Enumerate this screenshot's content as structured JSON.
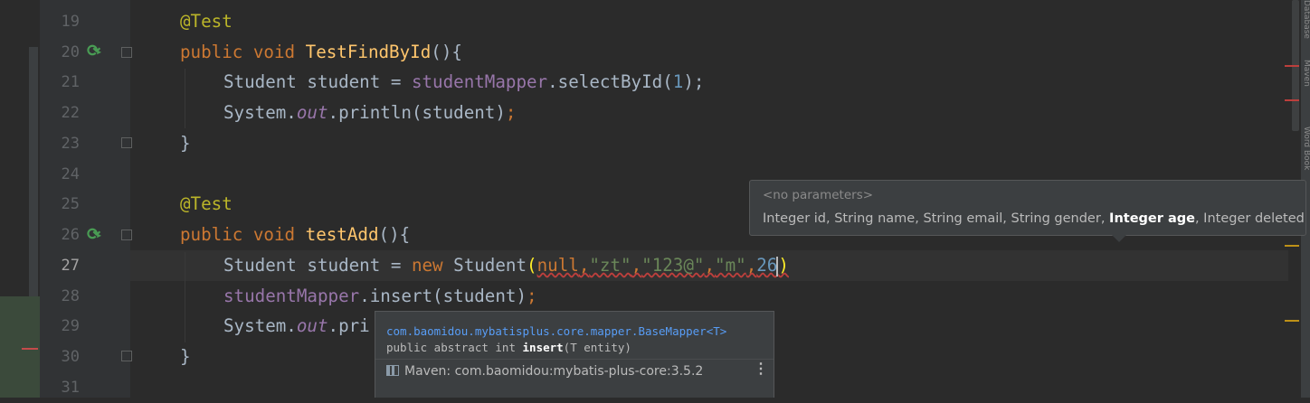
{
  "editor": {
    "line_numbers": [
      "19",
      "20",
      "21",
      "22",
      "23",
      "24",
      "25",
      "26",
      "27",
      "28",
      "29",
      "30",
      "31"
    ],
    "current_line": "27",
    "code": {
      "l19_annotation": "@Test",
      "l20_public": "public ",
      "l20_void": "void ",
      "l20_name": "TestFindById",
      "l20_rest": "(){",
      "l21_a": "Student student = ",
      "l21_field": "studentMapper",
      "l21_b": ".selectById(",
      "l21_num": "1",
      "l21_c": ");",
      "l22_a": "System.",
      "l22_field": "out",
      "l22_b": ".println(student)",
      "l22_c": ";",
      "l23": "}",
      "l25_annotation": "@Test",
      "l26_public": "public ",
      "l26_void": "void ",
      "l26_name": "testAdd",
      "l26_rest": "(){",
      "l27_a": "Student student = ",
      "l27_new": "new ",
      "l27_b": "Student",
      "l27_open": "(",
      "l27_null": "null",
      "l27_comma": ",",
      "l27_s1": "\"zt\"",
      "l27_s2": "\"123@\"",
      "l27_s3": "\"m\"",
      "l27_num": "26",
      "l27_close": ")",
      "l28_field": "studentMapper",
      "l28_b": ".insert(student)",
      "l28_c": ";",
      "l29_a": "System.",
      "l29_field": "out",
      "l29_b": ".pri",
      "l30": "}"
    }
  },
  "param_popup": {
    "hint": "<no parameters>",
    "sig_before": "Integer id, String name, String email, String gender, ",
    "sig_bold": "Integer age",
    "sig_after": ", Integer deleted"
  },
  "doc_popup": {
    "class_name": "com.baomidou.mybatisplus.core.mapper.BaseMapper<T>",
    "sig_before": "public abstract int ",
    "sig_bold": "insert",
    "sig_after": "(T entity)",
    "maven": "Maven: com.baomidou:mybatis-plus-core:3.5.2",
    "more_icon": "⋮"
  },
  "side_tabs": [
    "Database",
    "Maven",
    "Word Book"
  ],
  "colors": {
    "background": "#2b2b2b",
    "keyword": "#cc7832",
    "annotation": "#bbb529",
    "method": "#ffc66d",
    "field": "#9876aa",
    "number": "#6897bb",
    "string": "#6a8759",
    "error_stripe": "#bc3f3c",
    "warning_stripe": "#be9117"
  }
}
